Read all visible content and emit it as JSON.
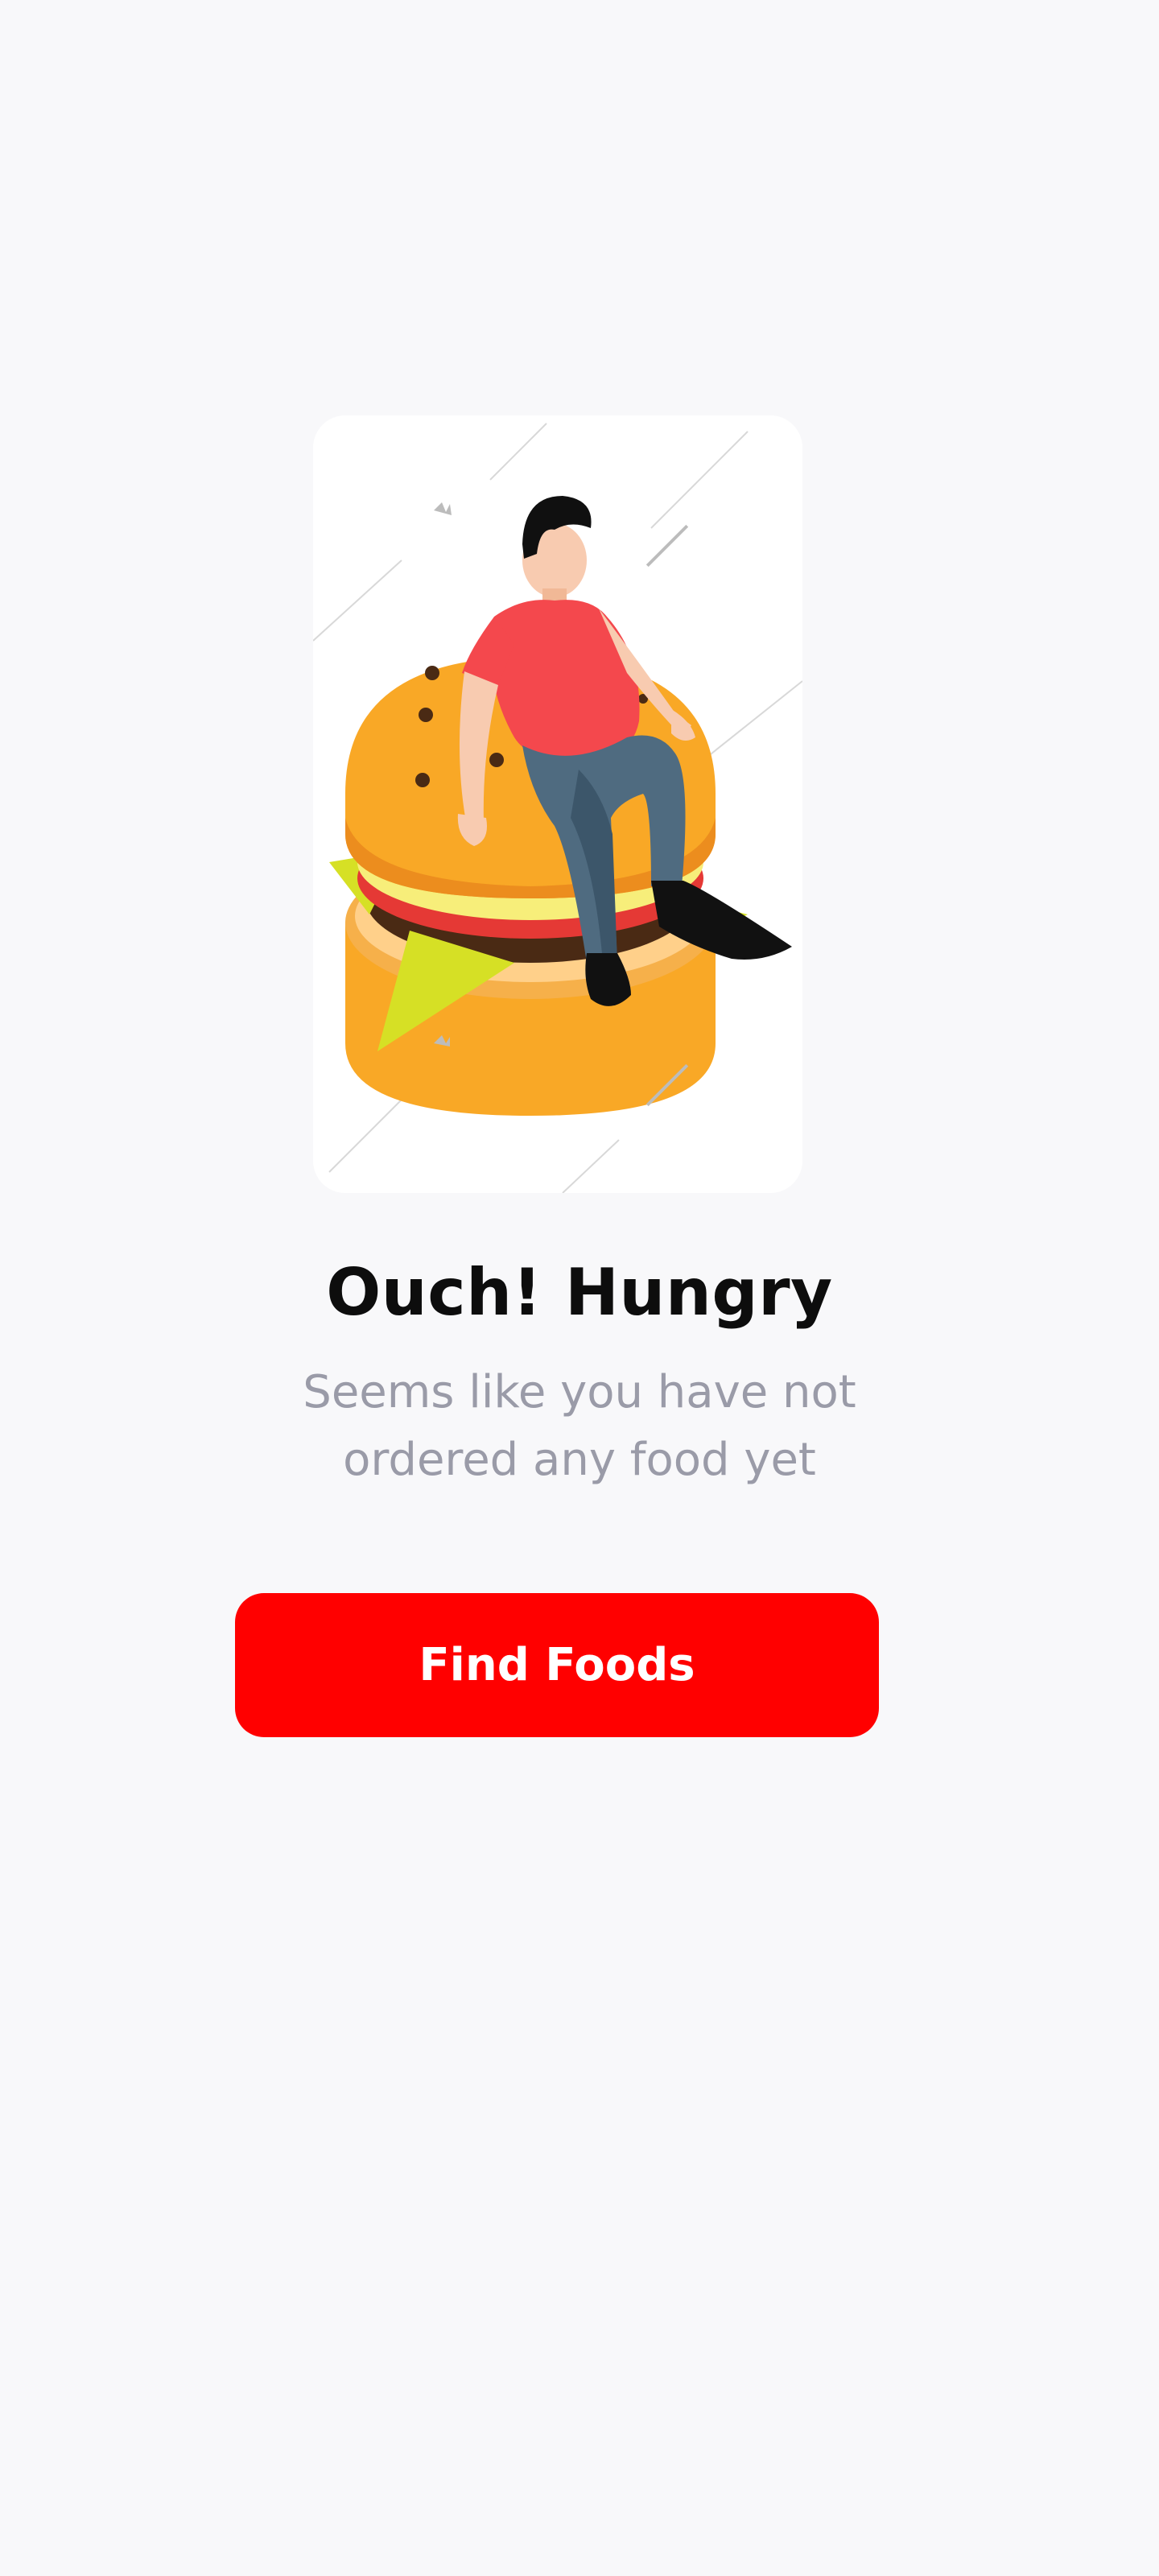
{
  "empty_state": {
    "illustration_icon": "person-on-burger-illustration",
    "title": "Ouch! Hungry",
    "message": "Seems like you have not ordered any food yet",
    "button_label": "Find Foods"
  },
  "colors": {
    "background": "#f8f8fa",
    "card": "#ffffff",
    "button": "#ff0000",
    "button_text": "#ffffff",
    "title": "#0d0d0d",
    "message": "#9a9ba8",
    "bun": "#f9a826",
    "shirt": "#f4484d",
    "jeans": "#4f6b80"
  }
}
